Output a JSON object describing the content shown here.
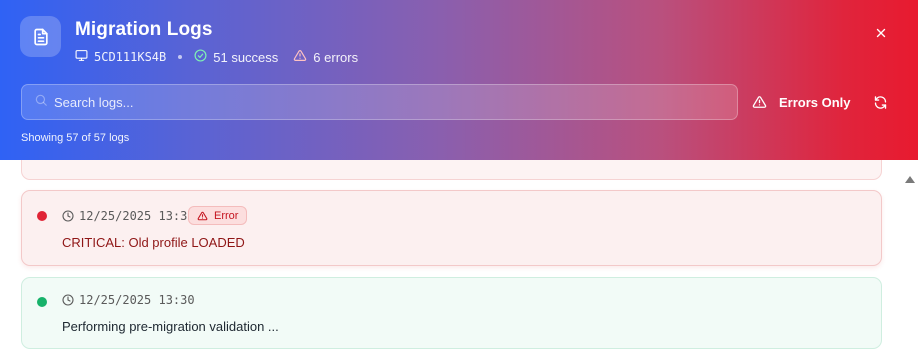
{
  "header": {
    "title": "Migration Logs",
    "device_id": "5CD111KS4B",
    "success_label": "51 success",
    "error_label": "6 errors",
    "app_icon": "document-icon",
    "close_icon": "close-icon"
  },
  "search": {
    "placeholder": "Search logs...",
    "value": ""
  },
  "toolbar": {
    "errors_only_label": "Errors Only",
    "refresh_icon": "refresh-icon"
  },
  "summary": {
    "showing_text": "Showing 57 of 57 logs"
  },
  "logs": [
    {
      "level": "error",
      "timestamp": "12/25/2025 13:30",
      "badge": "Error",
      "message": "CRITICAL: Old profile LOADED"
    },
    {
      "level": "success",
      "timestamp": "12/25/2025 13:30",
      "message": "Performing pre-migration validation ..."
    }
  ],
  "colors": {
    "gradient_start": "#2f62f5",
    "gradient_end": "#e81a2f",
    "error": "#e02436",
    "success": "#17b26a"
  }
}
